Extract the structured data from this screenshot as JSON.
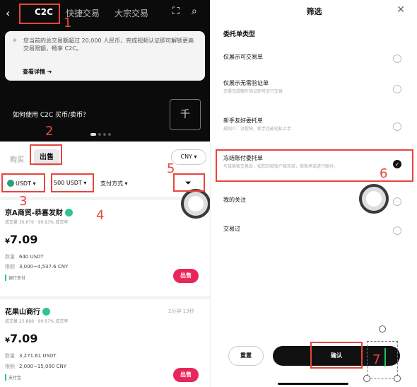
{
  "left": {
    "nav": {
      "back": "‹",
      "tab_c2c": "C2C",
      "tab_quick": "快捷交易",
      "tab_block": "大宗交易"
    },
    "notice": {
      "text": "您当前的总交易额超过 20,000 人民币，完成视频认证即可解锁更高交易限额，畅享 C2C。",
      "link": "查看详情 ➔"
    },
    "promo": "如何使用 C2C 买币/卖币？",
    "promo_icon": "千",
    "tabs": {
      "buy": "购买",
      "sell": "出售",
      "currency": "CNY ▾"
    },
    "filters": {
      "coin": "USDT ▾",
      "amount": "500 USDT ▾",
      "payment": "支付方式 ▾"
    },
    "merchants": [
      {
        "name": "京A商贸-恭喜发财",
        "stats": "成交量 36,676 · 99.93% 成交率",
        "time": "",
        "price_symbol": "¥",
        "price": "7.09",
        "qty_label": "数量",
        "qty": "640 USDT",
        "limit_label": "限额",
        "limit": "3,000~4,537.6 CNY",
        "pay": "银行支付",
        "button": "出售"
      },
      {
        "name": "花果山商行",
        "stats": "成交量 25,888 · 99.97% 成交率",
        "time": "2分钟 13秒",
        "price_symbol": "¥",
        "price": "7.09",
        "qty_label": "数量",
        "qty": "3,271.61 USDT",
        "limit_label": "限额",
        "limit": "2,000~15,000 CNY",
        "pay": "支付宝",
        "button": "出售"
      }
    ]
  },
  "right": {
    "title": "筛选",
    "close": "✕",
    "section": "委托单类型",
    "options": [
      {
        "title": "仅展示可交易单",
        "desc": "",
        "selected": false
      },
      {
        "title": "仅展示无需验证单",
        "desc": "无需完成额外验证即可进行交易",
        "selected": false
      },
      {
        "title": "新手友好委托单",
        "desc": "规则少、流程快，新手也能轻松上手",
        "selected": false
      },
      {
        "title": "冻结账付委托单",
        "desc": "与该商家交易后，如您的款账户被冻结，商家承诺进行赔付。",
        "selected": true
      },
      {
        "title": "我的关注",
        "desc": "",
        "selected": false
      },
      {
        "title": "交易过",
        "desc": "",
        "selected": false
      }
    ],
    "reset": "重置",
    "confirm": "确认"
  },
  "annotations": [
    "1",
    "2",
    "3",
    "4",
    "5",
    "6",
    "7"
  ],
  "colors": {
    "highlight": "#e8453c",
    "sell_button": "#e8265a",
    "verified": "#2fc48d",
    "usdt": "#26a17b"
  }
}
